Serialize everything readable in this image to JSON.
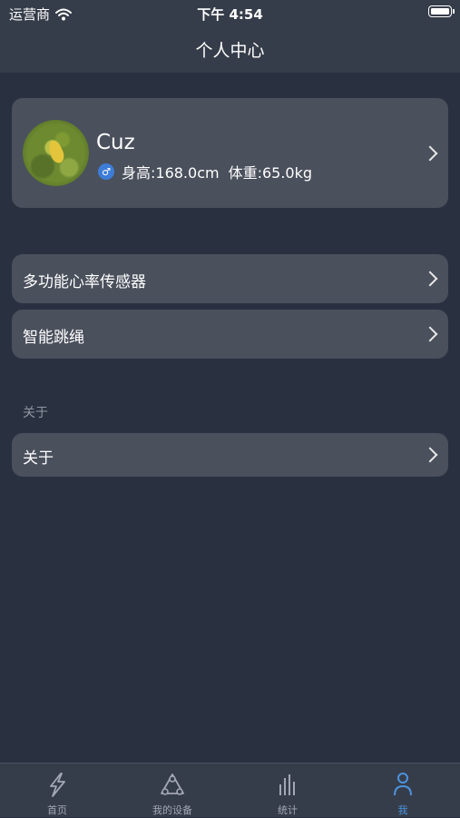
{
  "status_bar": {
    "carrier": "运营商",
    "time": "下午 4:54"
  },
  "nav": {
    "title": "个人中心"
  },
  "profile": {
    "name": "Cuz",
    "gender_symbol": "♂",
    "height": "身高:168.0cm",
    "weight": "体重:65.0kg"
  },
  "devices": [
    {
      "label": "多功能心率传感器"
    },
    {
      "label": "智能跳绳"
    }
  ],
  "about_section": {
    "header": "关于",
    "row_label": "关于"
  },
  "tabs": [
    {
      "label": "首页",
      "icon": "lightning-icon",
      "active": false
    },
    {
      "label": "我的设备",
      "icon": "devices-icon",
      "active": false
    },
    {
      "label": "统计",
      "icon": "bar-chart-icon",
      "active": false
    },
    {
      "label": "我",
      "icon": "person-icon",
      "active": true
    }
  ],
  "colors": {
    "background": "#293141",
    "card": "#4a505c",
    "bar": "#363d4a",
    "accent": "#4c93de",
    "inactive": "#a2a8b3"
  }
}
